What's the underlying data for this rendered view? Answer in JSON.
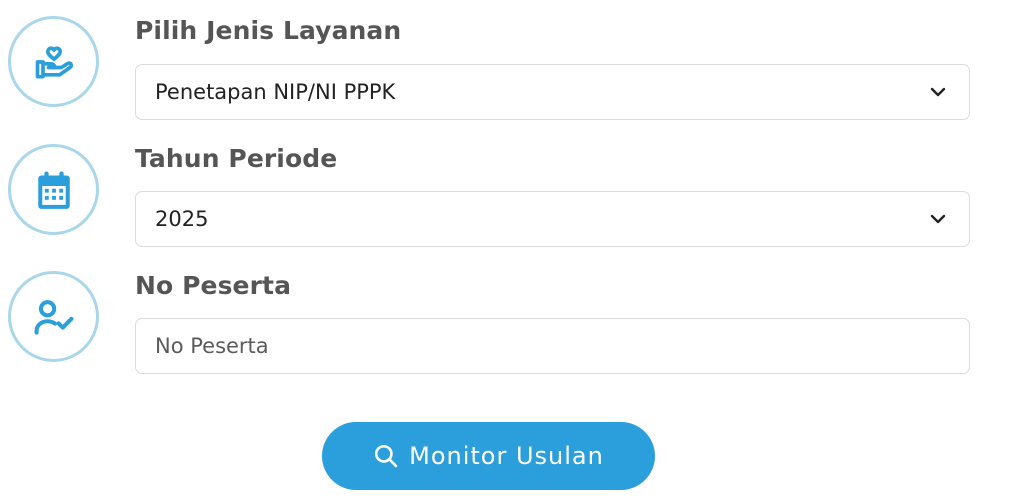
{
  "theme": {
    "accent": "#2a9fdb",
    "icon_ring": "#a9d6ea",
    "label_color": "#555555",
    "border": "#dcdcdc"
  },
  "form": {
    "service_type": {
      "label": "Pilih Jenis Layanan",
      "selected": "Penetapan NIP/NI PPPK",
      "icon": "heart-hand-icon"
    },
    "period_year": {
      "label": "Tahun Periode",
      "selected": "2025",
      "icon": "calendar-icon"
    },
    "participant_no": {
      "label": "No Peserta",
      "placeholder": "No Peserta",
      "value": "",
      "icon": "user-check-icon"
    },
    "submit": {
      "label": "Monitor Usulan",
      "icon": "search-icon"
    }
  }
}
